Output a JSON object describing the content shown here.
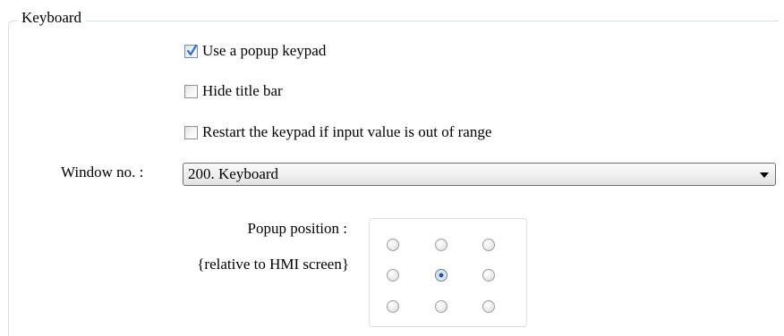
{
  "group": {
    "title": "Keyboard"
  },
  "options": [
    {
      "label": "Use a popup keypad",
      "checked": true
    },
    {
      "label": "Hide title bar",
      "checked": false
    },
    {
      "label": "Restart the keypad if input value is out of range",
      "checked": false
    }
  ],
  "window": {
    "label": "Window no. :",
    "selected": "200. Keyboard"
  },
  "popup": {
    "label": "Popup position :",
    "sublabel": "{relative to HMI screen}",
    "selected_position": "middle-center"
  },
  "colors": {
    "frame": "#d5dfe5",
    "check_accent": "#3a6fc4",
    "radio_selected": "#1e4b8f"
  }
}
